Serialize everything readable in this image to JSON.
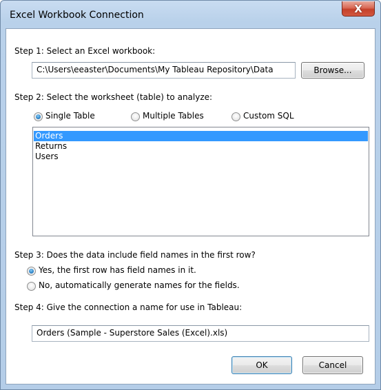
{
  "window": {
    "title": "Excel Workbook Connection",
    "close_glyph": "X"
  },
  "step1": {
    "label": "Step 1: Select an Excel workbook:",
    "path_value": "C:\\Users\\eeaster\\Documents\\My Tableau Repository\\Data",
    "browse_label": "Browse..."
  },
  "step2": {
    "label": "Step 2: Select the worksheet (table) to analyze:",
    "options": [
      {
        "label": "Single Table",
        "checked": true
      },
      {
        "label": "Multiple Tables",
        "checked": false
      },
      {
        "label": "Custom SQL",
        "checked": false
      }
    ],
    "tables": [
      {
        "label": "Orders",
        "selected": true
      },
      {
        "label": "Returns",
        "selected": false
      },
      {
        "label": "Users",
        "selected": false
      }
    ]
  },
  "step3": {
    "label": "Step 3: Does the data include field names in the first row?",
    "options": [
      {
        "label": "Yes, the first row has field names in it.",
        "checked": true
      },
      {
        "label": "No, automatically generate names for the fields.",
        "checked": false
      }
    ]
  },
  "step4": {
    "label": "Step 4: Give the connection a name for use in Tableau:",
    "connection_name": "Orders (Sample - Superstore Sales (Excel).xls)"
  },
  "buttons": {
    "ok": "OK",
    "cancel": "Cancel"
  }
}
